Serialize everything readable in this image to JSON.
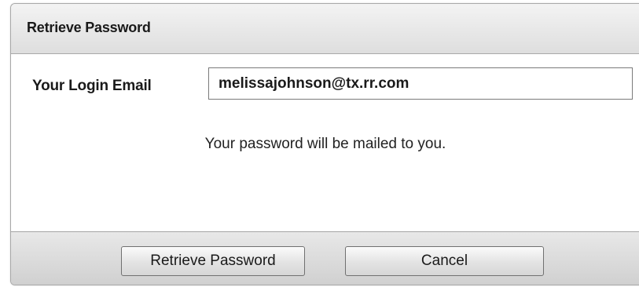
{
  "dialog": {
    "title": "Retrieve Password",
    "field_label": "Your Login Email",
    "email_value": "melissajohnson@tx.rr.com",
    "message": "Your password will be mailed to you.",
    "buttons": {
      "retrieve": "Retrieve Password",
      "cancel": "Cancel"
    }
  },
  "colors": {
    "titlebar": "#e6e6e6",
    "footer": "#dcdcdc",
    "border": "#a8a8a8",
    "text": "#1a1a1a"
  }
}
